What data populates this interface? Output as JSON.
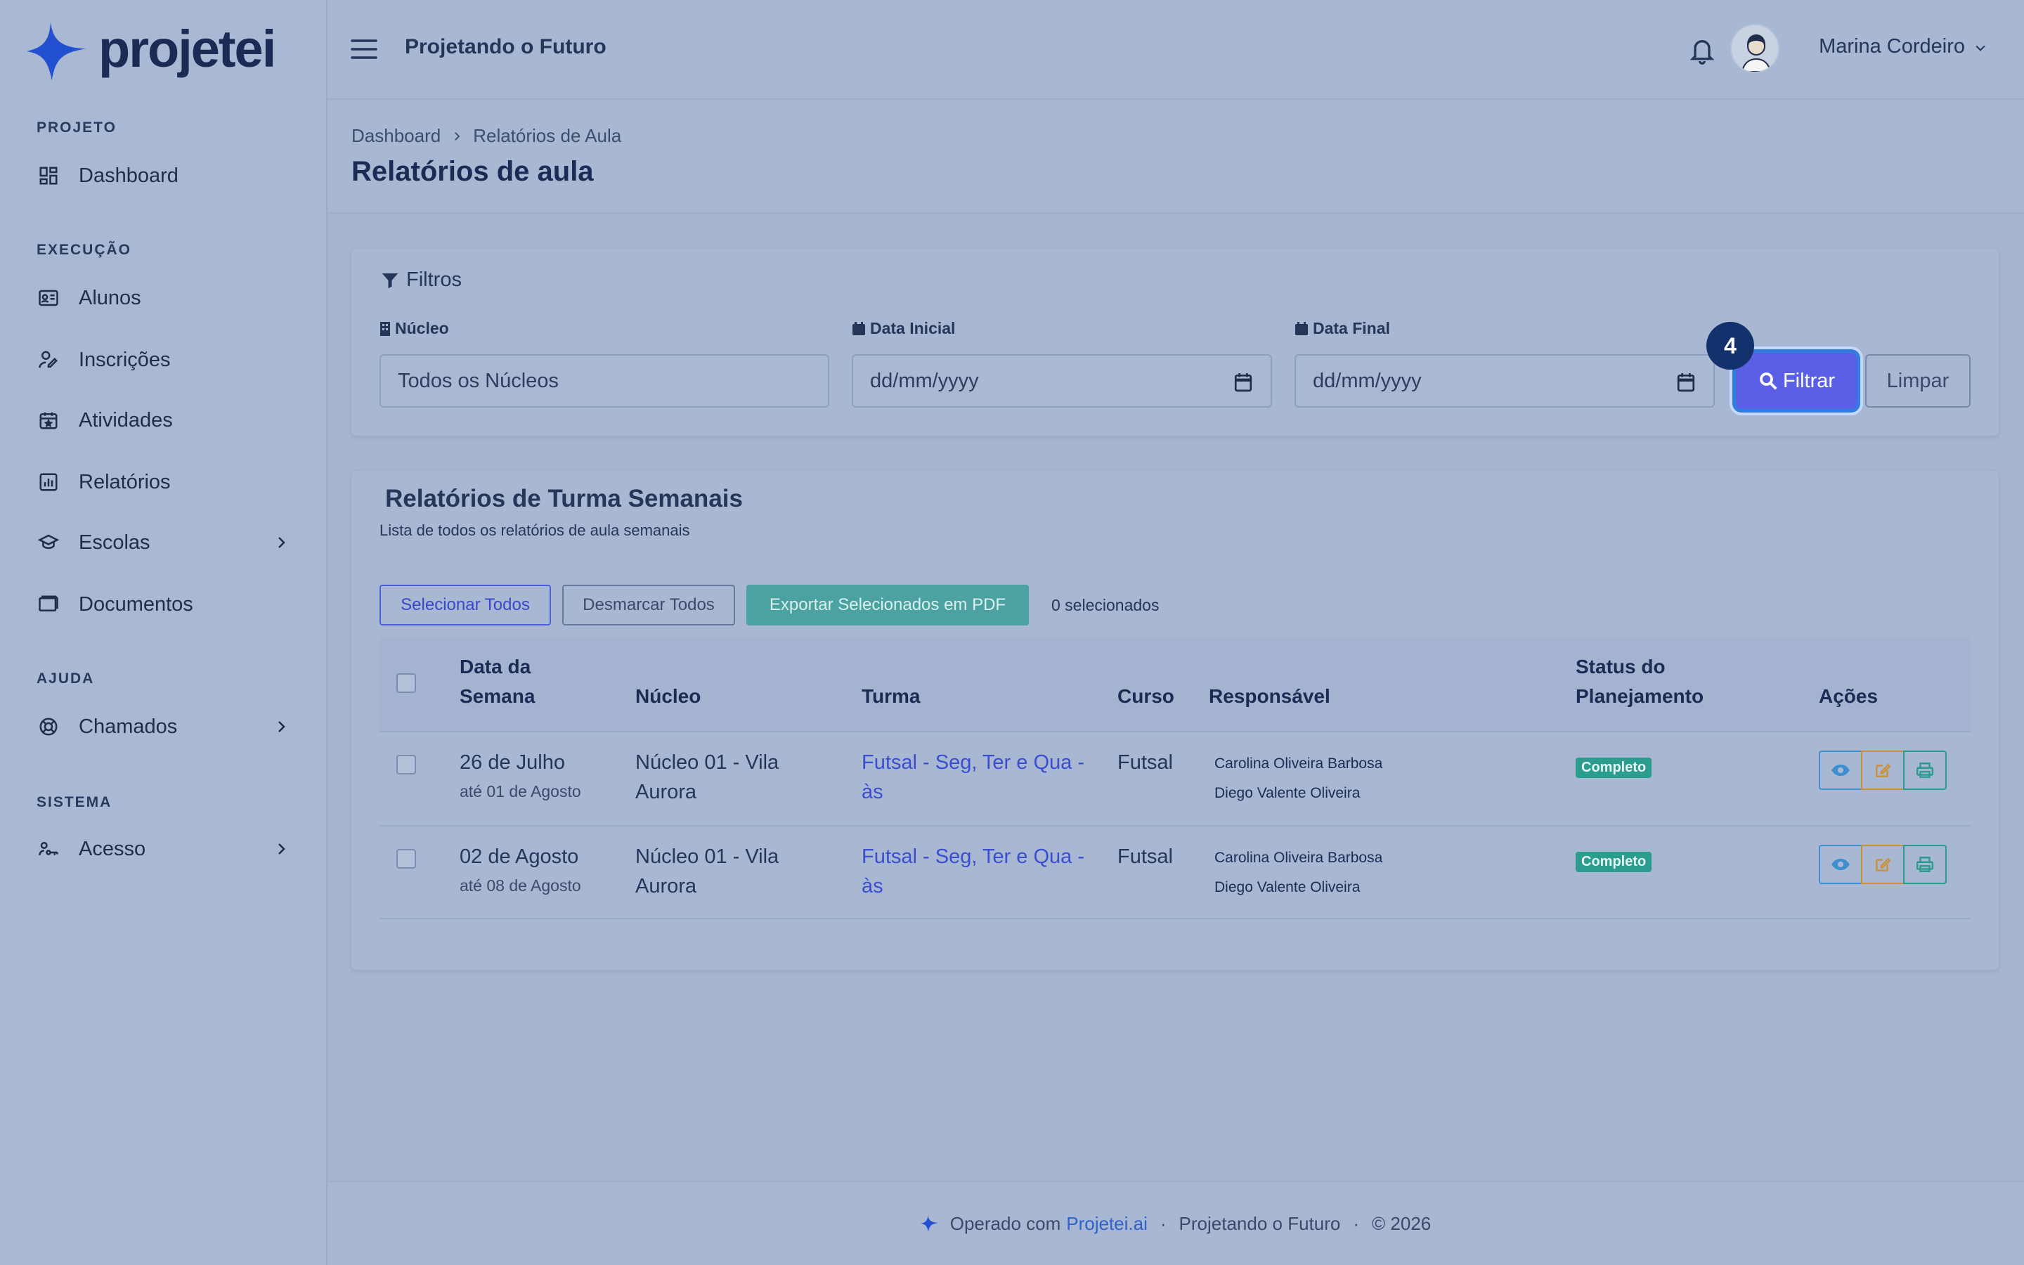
{
  "brand": {
    "name": "projetei"
  },
  "header": {
    "project": "Projetando o Futuro",
    "user": "Marina Cordeiro"
  },
  "sidebar": {
    "sections": [
      "PROJETO",
      "EXECUÇÃO",
      "AJUDA",
      "SISTEMA"
    ],
    "items": [
      {
        "label": "Dashboard",
        "icon": "dashboard-icon"
      },
      {
        "label": "Alunos",
        "icon": "id-card-icon"
      },
      {
        "label": "Inscrições",
        "icon": "user-edit-icon"
      },
      {
        "label": "Atividades",
        "icon": "calendar-star-icon"
      },
      {
        "label": "Relatórios",
        "icon": "chart-icon"
      },
      {
        "label": "Escolas",
        "icon": "school-icon"
      },
      {
        "label": "Documentos",
        "icon": "folder-icon"
      },
      {
        "label": "Chamados",
        "icon": "lifebuoy-icon"
      },
      {
        "label": "Acesso",
        "icon": "user-key-icon"
      }
    ]
  },
  "page": {
    "breadcrumb": [
      "Dashboard",
      "Relatórios de Aula"
    ],
    "title": "Relatórios de aula"
  },
  "filters": {
    "title": "Filtros",
    "nucleo_label": "Núcleo",
    "nucleo_value": "Todos os Núcleos",
    "data_inicial_label": "Data Inicial",
    "data_inicial_value": "dd/mm/yyyy",
    "data_final_label": "Data Final",
    "data_final_value": "dd/mm/yyyy",
    "filtrar_label": "Filtrar",
    "limpar_label": "Limpar",
    "step_badge": "4"
  },
  "reports": {
    "title": "Relatórios de Turma Semanais",
    "subtitle": "Lista de todos os relatórios de aula semanais",
    "select_all": "Selecionar Todos",
    "deselect_all": "Desmarcar Todos",
    "export": "Exportar Selecionados em PDF",
    "selected_count": "0 selecionados",
    "columns": [
      "Data da Semana",
      "Núcleo",
      "Turma",
      "Curso",
      "Responsável",
      "Status do Planejamento",
      "Ações"
    ],
    "rows": [
      {
        "date": "26 de Julho",
        "date_sub": "até 01 de Agosto",
        "nucleo": "Núcleo 01 - Vila Aurora",
        "turma": "Futsal - Seg, Ter e Qua - às",
        "curso": "Futsal",
        "resp1": "Carolina Oliveira Barbosa",
        "resp2": "Diego Valente Oliveira",
        "status": "Completo"
      },
      {
        "date": "02 de Agosto",
        "date_sub": "até 08 de Agosto",
        "nucleo": "Núcleo 01 - Vila Aurora",
        "turma": "Futsal - Seg, Ter e Qua - às",
        "curso": "Futsal",
        "resp1": "Carolina Oliveira Barbosa",
        "resp2": "Diego Valente Oliveira",
        "status": "Completo"
      }
    ]
  },
  "footer": {
    "operated": "Operado com",
    "brand_link": "Projetei.ai",
    "project": "Projetando o Futuro",
    "copyright": "© 2026"
  }
}
